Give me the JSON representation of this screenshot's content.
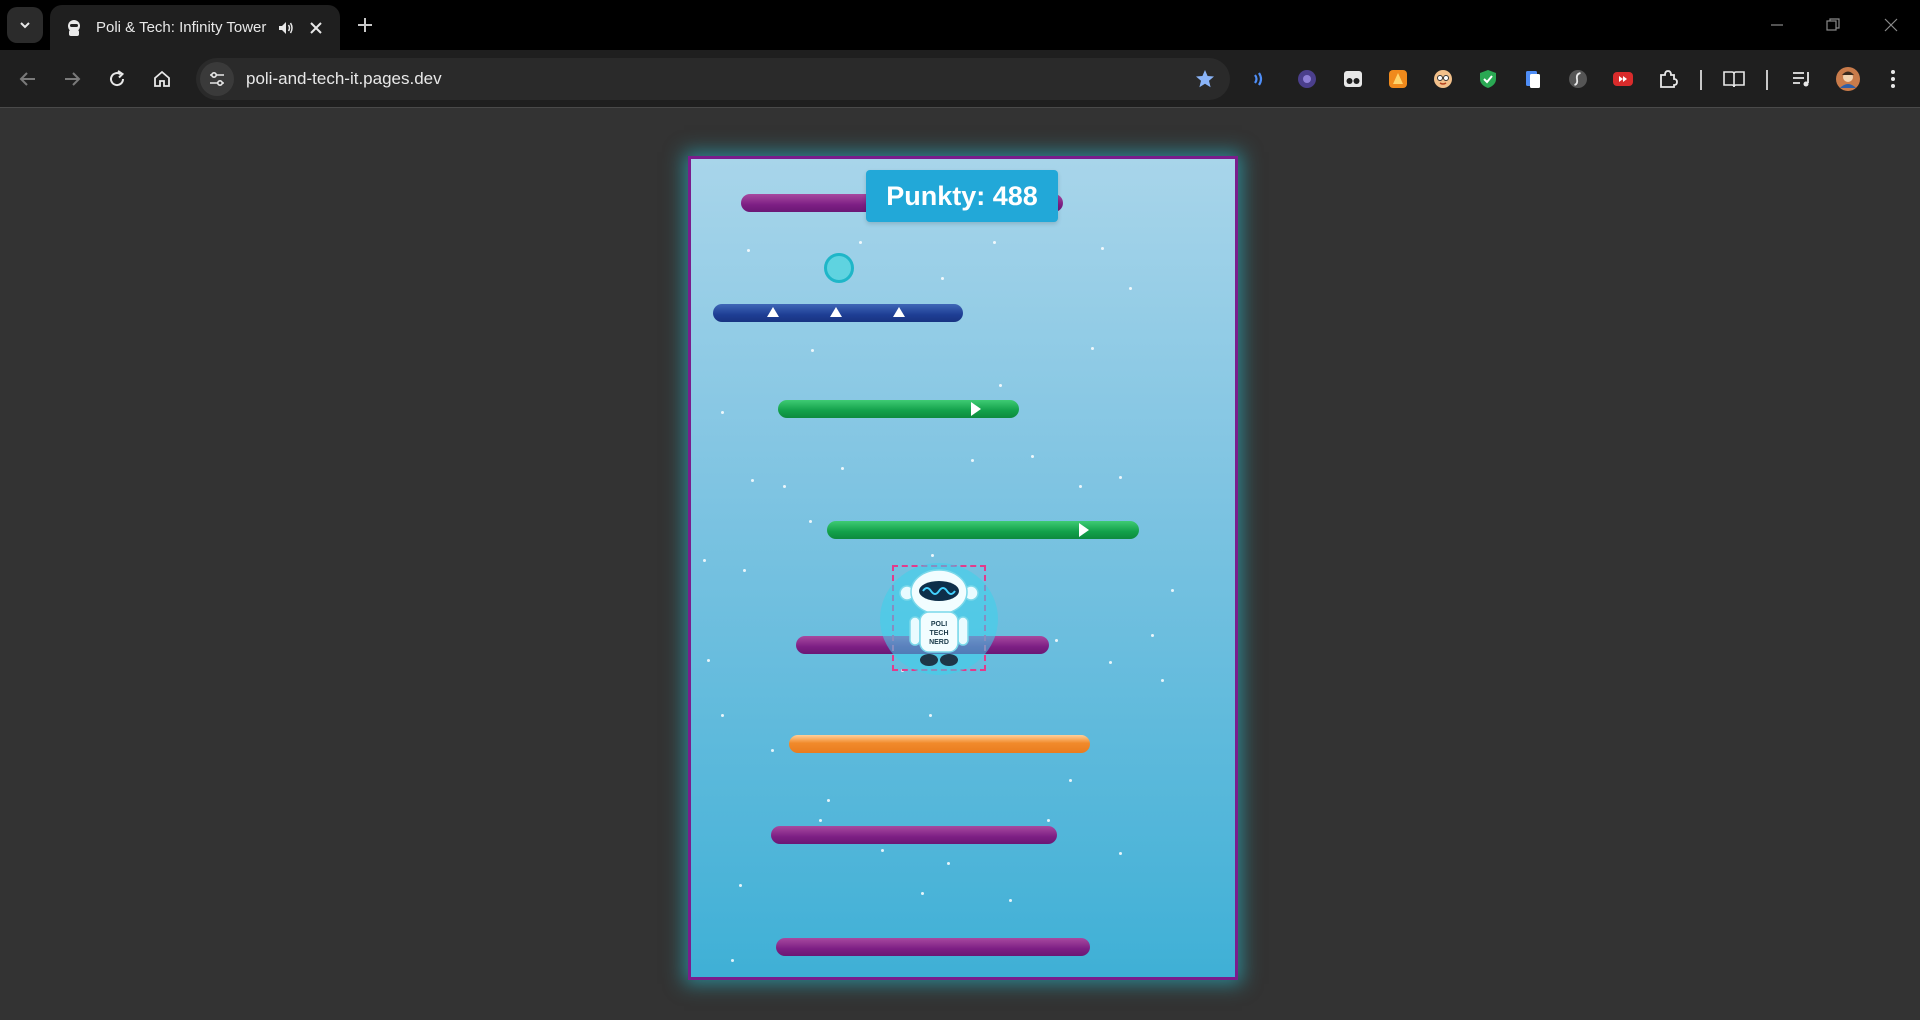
{
  "browser": {
    "tab": {
      "title": "Poli & Tech: Infinity Tower"
    },
    "url": "poli-and-tech-it.pages.dev"
  },
  "game": {
    "score_text": "Punkty: 488",
    "platforms": [
      {
        "color": "purple",
        "marks": ""
      },
      {
        "color": "blue",
        "marks": "spikes"
      },
      {
        "color": "green",
        "marks": "arrow-right"
      },
      {
        "color": "green",
        "marks": "arrow-right"
      },
      {
        "color": "purple",
        "marks": ""
      },
      {
        "color": "orange",
        "marks": ""
      },
      {
        "color": "purple",
        "marks": ""
      },
      {
        "color": "purple",
        "marks": ""
      }
    ],
    "player": {
      "name": "robot",
      "chest_text": [
        "POLI",
        "TECH",
        "NERD"
      ]
    }
  },
  "colors": {
    "frame": "#7a1d8c",
    "glow": "#2cc8dc",
    "score_bg": "#22a8d8",
    "page_bg": "#333333"
  }
}
